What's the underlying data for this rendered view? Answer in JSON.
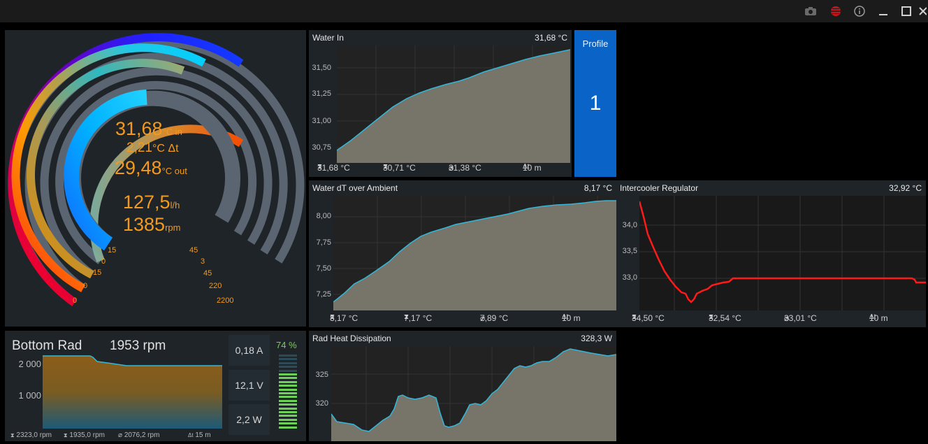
{
  "titlebar": {
    "icons": [
      "camera-icon",
      "record-icon",
      "info-icon",
      "minimize-icon",
      "maximize-icon",
      "close-icon"
    ]
  },
  "gauge": {
    "temp_in_value": "31,68",
    "temp_in_unit": "°C in",
    "delta_value": "2,21",
    "delta_unit": "°C Δt",
    "temp_out_value": "29,48",
    "temp_out_unit": "°C out",
    "flow_value": "127,5",
    "flow_unit": "l/h",
    "rpm_value": "1385",
    "rpm_unit": "rpm",
    "left_scale": [
      "15",
      "0",
      "15",
      "0",
      "0"
    ],
    "right_scale": [
      "45",
      "3",
      "45",
      "220",
      "2200"
    ]
  },
  "water_in": {
    "title": "Water In",
    "value": "31,68 °C",
    "yticks": [
      "31,50",
      "31,25",
      "31,00",
      "30,75"
    ],
    "stats": {
      "max": "31,68 °C",
      "min": "30,71 °C",
      "avg": "31,38 °C",
      "window": "10 m"
    }
  },
  "profile": {
    "label": "Profile",
    "number": "1"
  },
  "water_dt": {
    "title": "Water dT over Ambient",
    "value": "8,17 °C",
    "yticks": [
      "8,00",
      "7,75",
      "7,50",
      "7,25"
    ],
    "stats": {
      "max": "8,17 °C",
      "min": "7,17 °C",
      "avg": "7,89 °C",
      "window": "10 m"
    }
  },
  "intercooler": {
    "title": "Intercooler Regulator",
    "value": "32,92 °C",
    "yticks": [
      "34,0",
      "33,5",
      "33,0"
    ],
    "stats": {
      "max": "34,50 °C",
      "min": "32,54 °C",
      "avg": "33,01 °C",
      "window": "10 m"
    }
  },
  "bottom_rad": {
    "title": "Bottom Rad",
    "rpm": "1953 rpm",
    "yticks": [
      "2 000",
      "1 000"
    ],
    "stats": {
      "max": "2323,0 rpm",
      "min": "1935,0 rpm",
      "avg": "2076,2 rpm",
      "window": "15 m"
    },
    "current": "0,18 A",
    "voltage": "12,1 V",
    "power": "2,2 W",
    "duty": "74 %"
  },
  "rad_heat": {
    "title": "Rad Heat Dissipation",
    "value": "328,3 W",
    "yticks": [
      "325",
      "320"
    ]
  },
  "symbols": {
    "max": "⧗",
    "min": "⧗",
    "avg": "⌀",
    "window": "Δt"
  },
  "colors": {
    "accent_orange": "#f39a1e",
    "area_fill": "#77746a",
    "line_cyan": "#34b6d8",
    "line_red": "#ff1a1a",
    "profile_blue": "#0a64c8"
  }
}
